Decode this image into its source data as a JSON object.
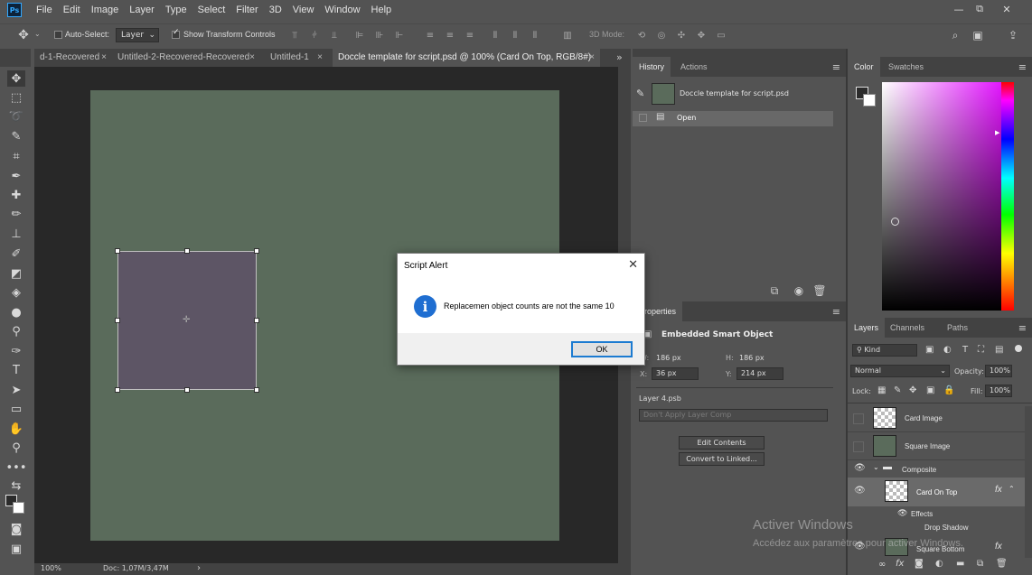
{
  "app": {
    "logo": "Ps"
  },
  "menubar": {
    "items": [
      "File",
      "Edit",
      "Image",
      "Layer",
      "Type",
      "Select",
      "Filter",
      "3D",
      "View",
      "Window",
      "Help"
    ]
  },
  "window_controls": {
    "minimize": "—",
    "restore": "⧉",
    "close": "✕"
  },
  "options_bar": {
    "auto_select_label": "Auto-Select:",
    "auto_select_value": "Layer",
    "show_transform_label": "Show Transform Controls",
    "three_d_mode_label": "3D Mode:"
  },
  "tabs": [
    {
      "label": "d-1-Recovered",
      "close": "×"
    },
    {
      "label": "Untitled-2-Recovered-Recovered",
      "close": "×"
    },
    {
      "label": "Untitled-1",
      "close": "×"
    },
    {
      "label": "Doccle template for script.psd @ 100% (Card On Top, RGB/8#)",
      "close": "×"
    }
  ],
  "tab_overflow": "»",
  "status": {
    "zoom": "100%",
    "doc": "Doc: 1,07M/3,47M",
    "arrow": "›"
  },
  "history_panel": {
    "tabs": [
      "History",
      "Actions"
    ],
    "snapshot_name": "Doccle template for script.psd",
    "steps": [
      "Open"
    ]
  },
  "properties_panel": {
    "tab": "Properties",
    "title": "Embedded Smart Object",
    "w_label": "W:",
    "w_value": "186 px",
    "h_label": "H:",
    "h_value": "186 px",
    "x_label": "X:",
    "x_value": "36 px",
    "y_label": "Y:",
    "y_value": "214 px",
    "source_file": "Layer 4.psb",
    "layer_comp": "Don't Apply Layer Comp",
    "edit_contents_label": "Edit Contents",
    "convert_label": "Convert to Linked..."
  },
  "color_panel": {
    "tabs": [
      "Color",
      "Swatches"
    ]
  },
  "layers_panel": {
    "tabs": [
      "Layers",
      "Channels",
      "Paths"
    ],
    "filter_kind": "Kind",
    "blend_mode": "Normal",
    "opacity_label": "Opacity:",
    "opacity_value": "100%",
    "lock_label": "Lock:",
    "fill_label": "Fill:",
    "fill_value": "100%",
    "layers": [
      {
        "name": "Card Image"
      },
      {
        "name": "Square Image"
      },
      {
        "name": "Composite"
      },
      {
        "name": "Card On Top"
      },
      {
        "name": "Effects"
      },
      {
        "name": "Drop Shadow"
      },
      {
        "name": "Square Bottom"
      }
    ],
    "fx_label": "fx"
  },
  "dialog": {
    "title": "Script Alert",
    "close": "✕",
    "icon_glyph": "i",
    "message": "Replacemen object counts are not the same 10",
    "ok_label": "OK"
  },
  "watermark": {
    "line1": "Activer Windows",
    "line2": "Accédez aux paramètres pour activer Windows."
  },
  "colors": {
    "canvas": "#5a6b5b",
    "card": "#5d5565",
    "accent": "#1c7bd1"
  }
}
